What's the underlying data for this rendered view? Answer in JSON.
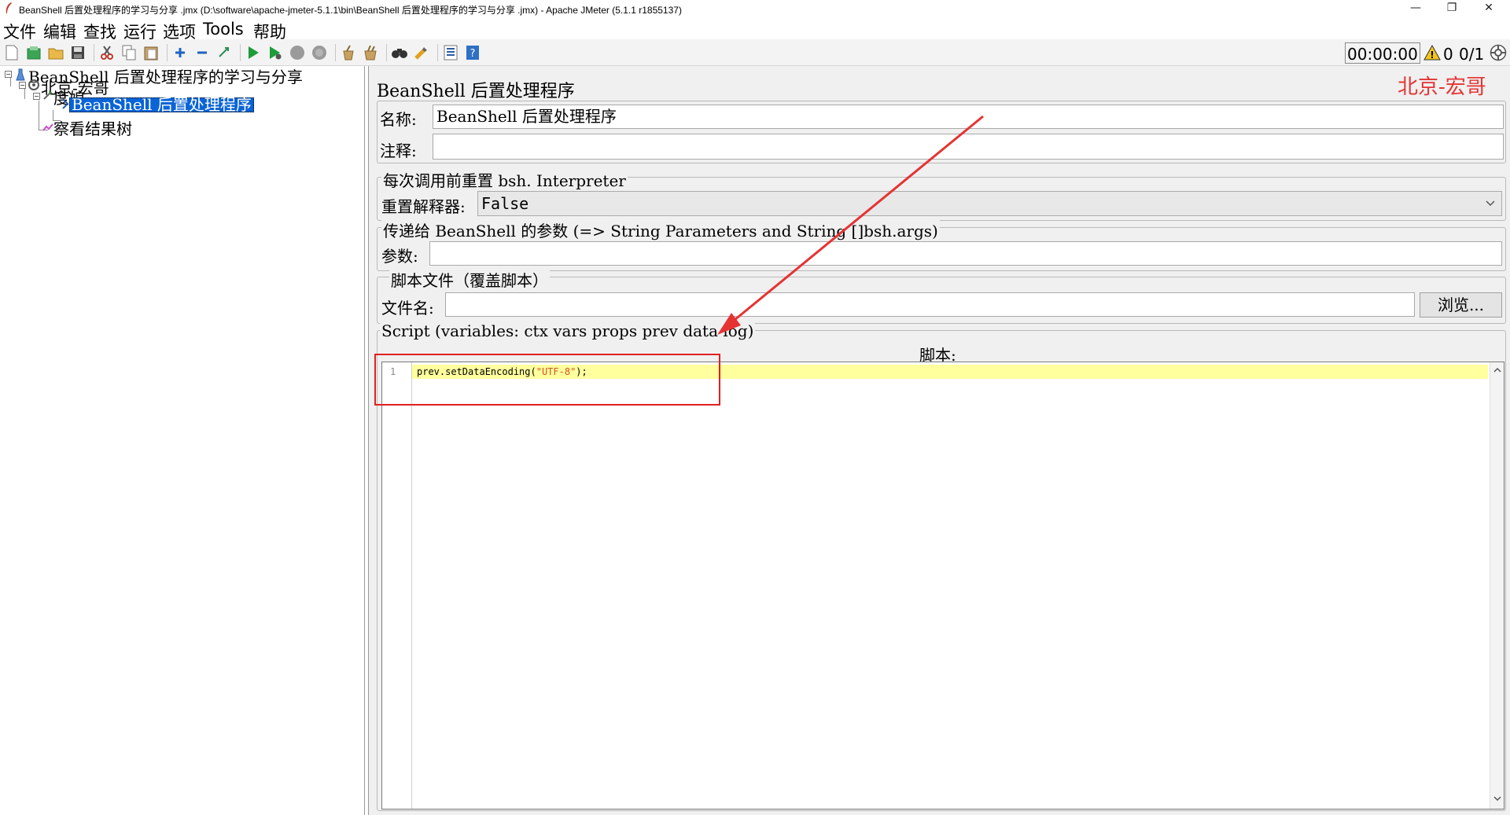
{
  "window": {
    "title": "BeanShell 后置处理程序的学习与分享 .jmx (D:\\software\\apache-jmeter-5.1.1\\bin\\BeanShell 后置处理程序的学习与分享 .jmx) - Apache JMeter (5.1.1 r1855137)",
    "minimize": "—",
    "restore": "❐",
    "close": "✕"
  },
  "menu": [
    "文件",
    "编辑",
    "查找",
    "运行",
    "选项",
    "Tools",
    "帮助"
  ],
  "toolbar": {
    "timer": "00:00:00",
    "warnings": "0",
    "threads": "0/1"
  },
  "tree": {
    "root": "BeanShell 后置处理程序的学习与分享",
    "thread_group": "北京-宏哥",
    "sampler": "度娘",
    "postprocessor": "BeanShell 后置处理程序",
    "listener": "察看结果树"
  },
  "panel": {
    "title": "BeanShell 后置处理程序",
    "watermark": "北京-宏哥",
    "name_label": "名称:",
    "name_value": "BeanShell 后置处理程序",
    "comment_label": "注释:",
    "comment_value": "",
    "reset_group": "每次调用前重置 bsh. Interpreter",
    "reset_label": "重置解释器:",
    "reset_value": "False",
    "params_group": "传递给 BeanShell 的参数 (=> String Parameters and String []bsh.args)",
    "params_label": "参数:",
    "params_value": "",
    "file_group": "脚本文件（覆盖脚本）",
    "file_label": "文件名:",
    "file_value": "",
    "browse_button": "浏览...",
    "script_group": "Script (variables: ctx vars props prev data log)",
    "script_label": "脚本:",
    "script_lines": [
      {
        "num": "1",
        "code": "prev.setDataEncoding(\"UTF-8\");"
      }
    ]
  }
}
